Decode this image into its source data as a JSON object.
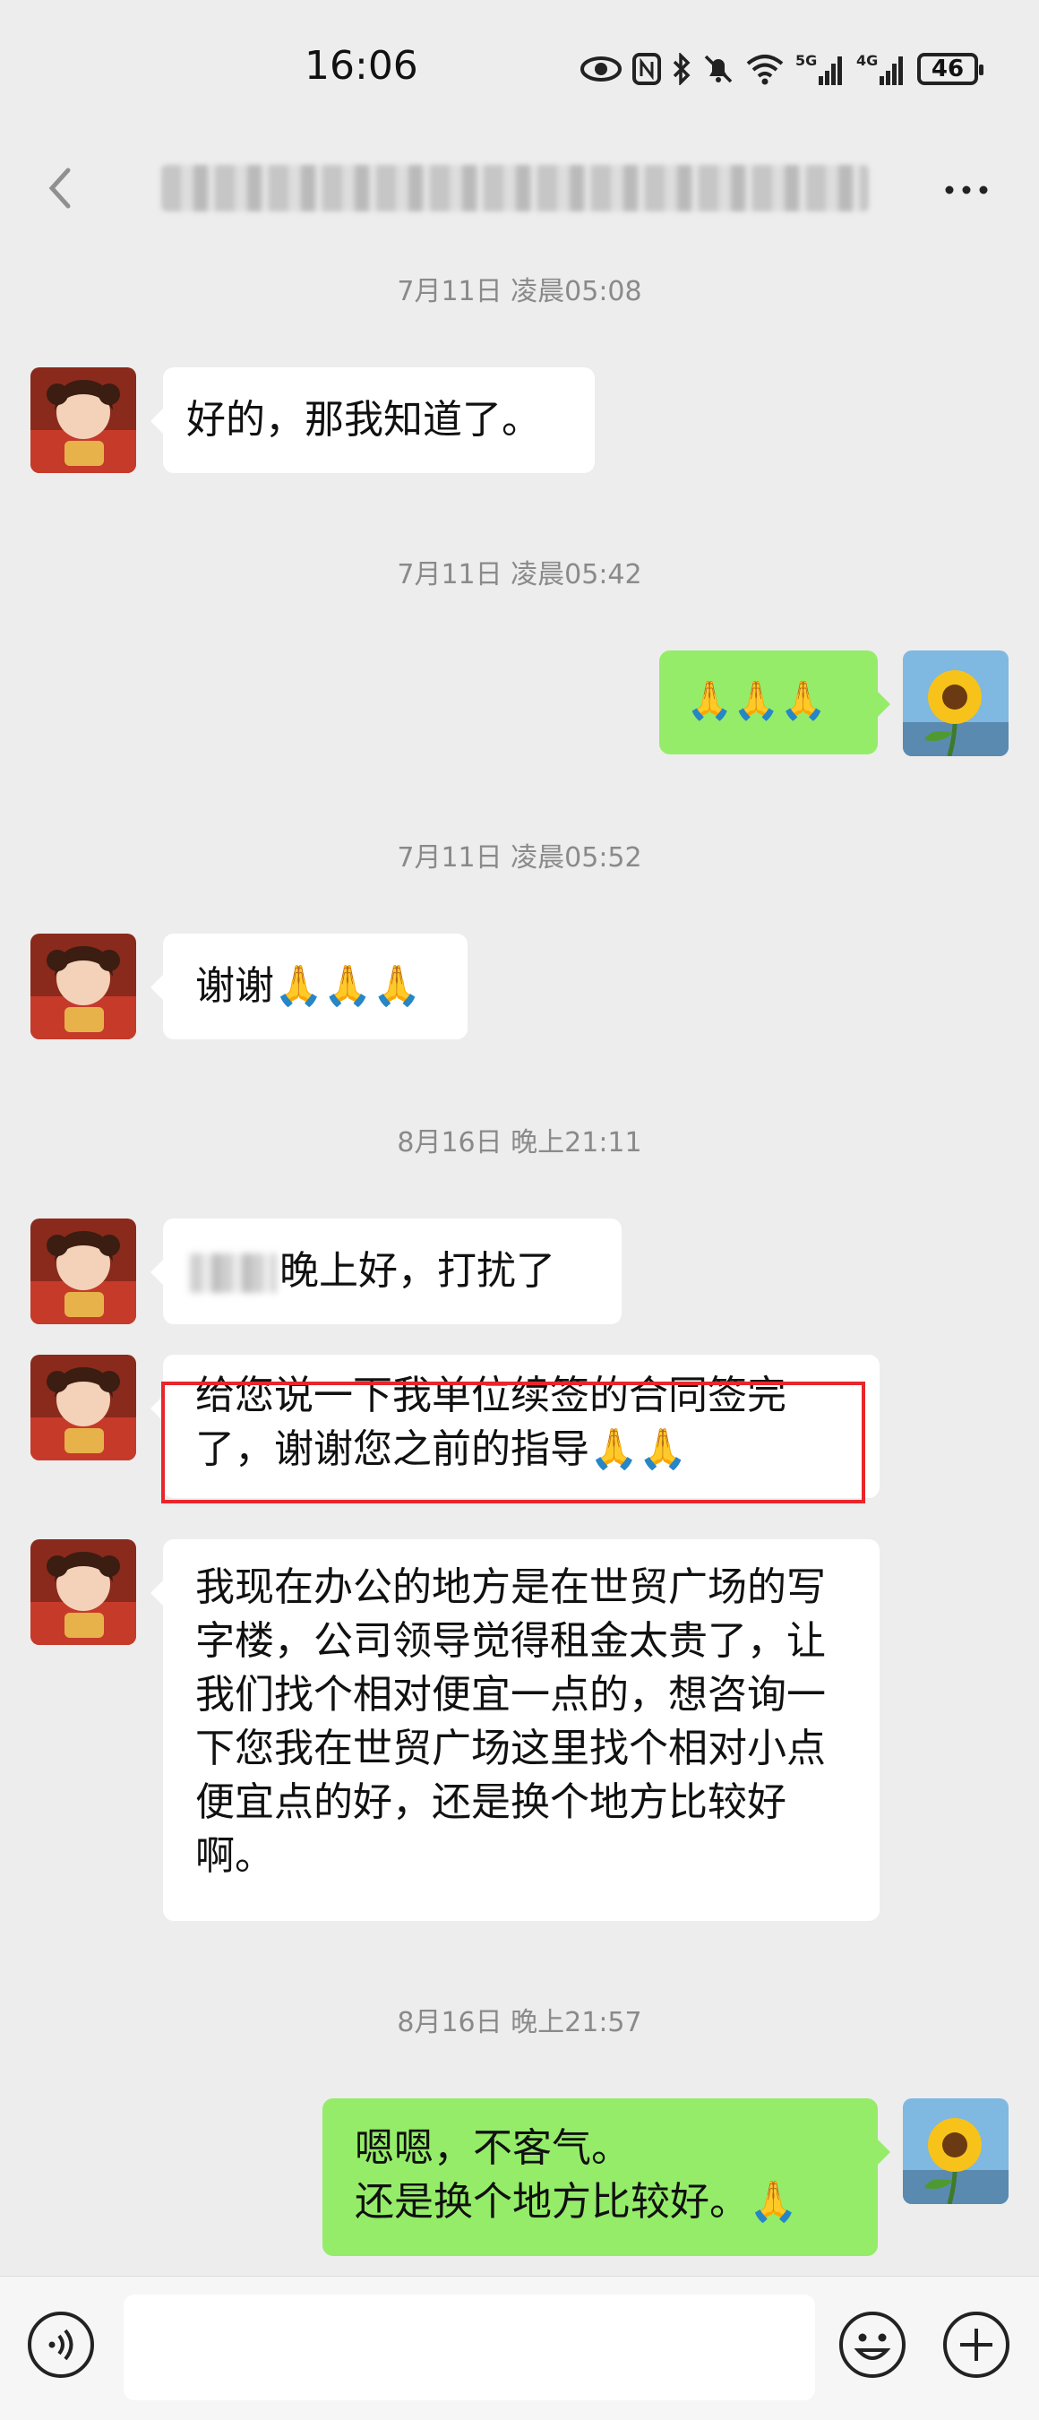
{
  "status_bar": {
    "time": "16:06",
    "icons": [
      "eye-icon",
      "nfc-icon",
      "bluetooth-icon",
      "mute-bell-icon",
      "wifi-icon",
      "5g-signal-icon",
      "4g-signal-icon"
    ],
    "signal_5g": "5G",
    "signal_4g": "4G",
    "battery": "46"
  },
  "nav": {
    "back_icon": "chevron-left-icon",
    "more_icon": "more-dots-icon"
  },
  "messages": [
    {
      "type": "timestamp",
      "text": "7月11日 凌晨05:08"
    },
    {
      "type": "incoming",
      "text": "好的，那我知道了。"
    },
    {
      "type": "timestamp",
      "text": "7月11日 凌晨05:42"
    },
    {
      "type": "outgoing",
      "text": "🙏🙏🙏"
    },
    {
      "type": "timestamp",
      "text": "7月11日 凌晨05:52"
    },
    {
      "type": "incoming",
      "text": "谢谢🙏🙏🙏"
    },
    {
      "type": "timestamp",
      "text": "8月16日 晚上21:11"
    },
    {
      "type": "incoming",
      "text": "晚上好，打扰了"
    },
    {
      "type": "incoming",
      "text": "给您说一下我单位续签的合同签完了，谢谢您之前的指导🙏🙏"
    },
    {
      "type": "incoming",
      "text": "我现在办公的地方是在世贸广场的写字楼，公司领导觉得租金太贵了，让我们找个相对便宜一点的，想咨询一下您我在世贸广场这里找个相对小点便宜点的好，还是换个地方比较好啊。"
    },
    {
      "type": "timestamp",
      "text": "8月16日 晚上21:57"
    },
    {
      "type": "outgoing",
      "text": "嗯嗯，不客气。\n还是换个地方比较好。🙏"
    }
  ],
  "bottom_bar": {
    "voice_icon": "voice-icon",
    "emoji_icon": "emoji-icon",
    "plus_icon": "plus-icon"
  }
}
